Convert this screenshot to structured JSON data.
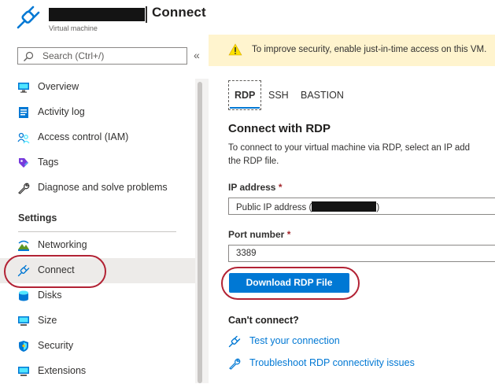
{
  "header": {
    "title": "Connect",
    "subtitle": "Virtual machine"
  },
  "sidebar": {
    "search_placeholder": "Search (Ctrl+/)",
    "collapse_label": "«",
    "items": [
      {
        "label": "Overview",
        "icon": "monitor-icon"
      },
      {
        "label": "Activity log",
        "icon": "activity-log-icon"
      },
      {
        "label": "Access control (IAM)",
        "icon": "users-icon"
      },
      {
        "label": "Tags",
        "icon": "tag-icon"
      },
      {
        "label": "Diagnose and solve problems",
        "icon": "wrench-icon"
      }
    ],
    "section_title": "Settings",
    "settings_items": [
      {
        "label": "Networking",
        "icon": "network-icon"
      },
      {
        "label": "Connect",
        "icon": "plug-icon",
        "selected": true
      },
      {
        "label": "Disks",
        "icon": "disk-icon"
      },
      {
        "label": "Size",
        "icon": "size-icon"
      },
      {
        "label": "Security",
        "icon": "shield-icon"
      },
      {
        "label": "Extensions",
        "icon": "extensions-icon"
      }
    ]
  },
  "banner": {
    "text": "To improve security, enable just-in-time access on this VM.",
    "color": "#fff4ce"
  },
  "tabs": [
    {
      "label": "RDP",
      "selected": true
    },
    {
      "label": "SSH"
    },
    {
      "label": "BASTION"
    }
  ],
  "main": {
    "heading": "Connect with RDP",
    "description_line1": "To connect to your virtual machine via RDP, select an IP add",
    "description_line2": "the RDP file.",
    "ip_label": "IP address",
    "required_marker": "*",
    "ip_value_prefix": "Public IP address (",
    "ip_value_suffix": ")",
    "port_label": "Port number",
    "port_value": "3389",
    "download_button": "Download RDP File",
    "cant_connect_title": "Can't connect?",
    "links": [
      {
        "label": "Test your connection",
        "icon": "plug-icon"
      },
      {
        "label": "Troubleshoot RDP connectivity issues",
        "icon": "wrench-icon"
      }
    ]
  },
  "colors": {
    "accent": "#0078d4",
    "highlight_oval": "#b22234",
    "selected_bg": "#edebe9"
  }
}
